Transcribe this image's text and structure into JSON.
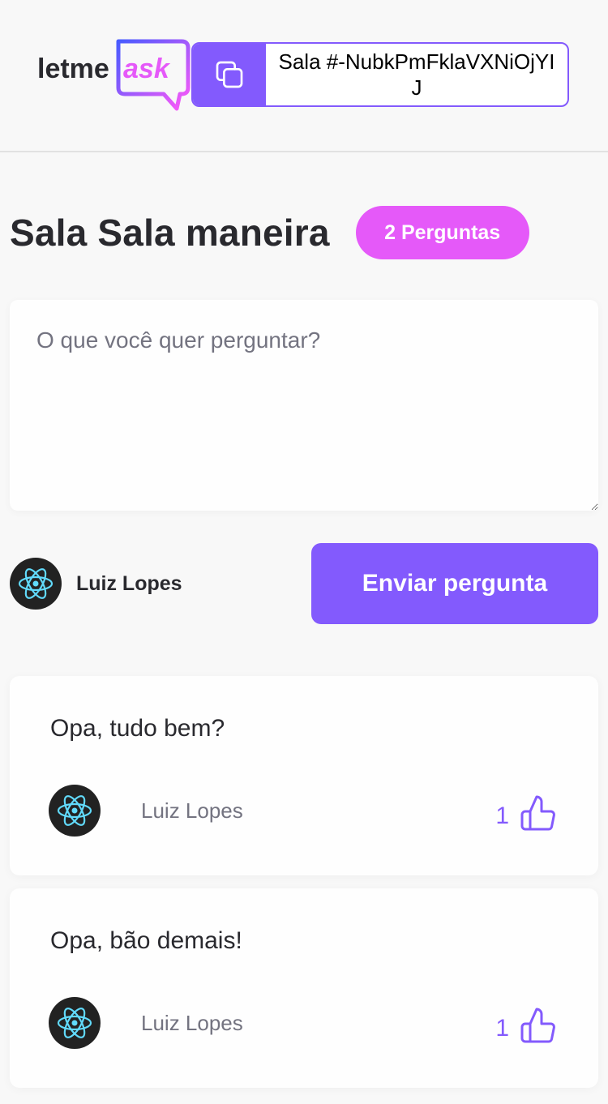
{
  "header": {
    "logo_text_prefix": "letme",
    "logo_text_accent": "ask",
    "room_code_label": "Sala #-NubkPmFklaVXNiOjYIJ",
    "copy_icon": "copy-icon"
  },
  "room": {
    "title": "Sala Sala maneira",
    "question_count_label": "2 Perguntas"
  },
  "form": {
    "placeholder": "O que você quer perguntar?",
    "value": "",
    "user_name": "Luiz Lopes",
    "submit_label": "Enviar pergunta"
  },
  "questions": [
    {
      "content": "Opa, tudo bem?",
      "author": "Luiz Lopes",
      "like_count": "1"
    },
    {
      "content": "Opa, bão demais!",
      "author": "Luiz Lopes",
      "like_count": "1"
    }
  ],
  "colors": {
    "primary": "#835afd",
    "pink": "#e559f9",
    "background": "#f8f8f8",
    "text": "#29292e",
    "muted": "#737380"
  }
}
